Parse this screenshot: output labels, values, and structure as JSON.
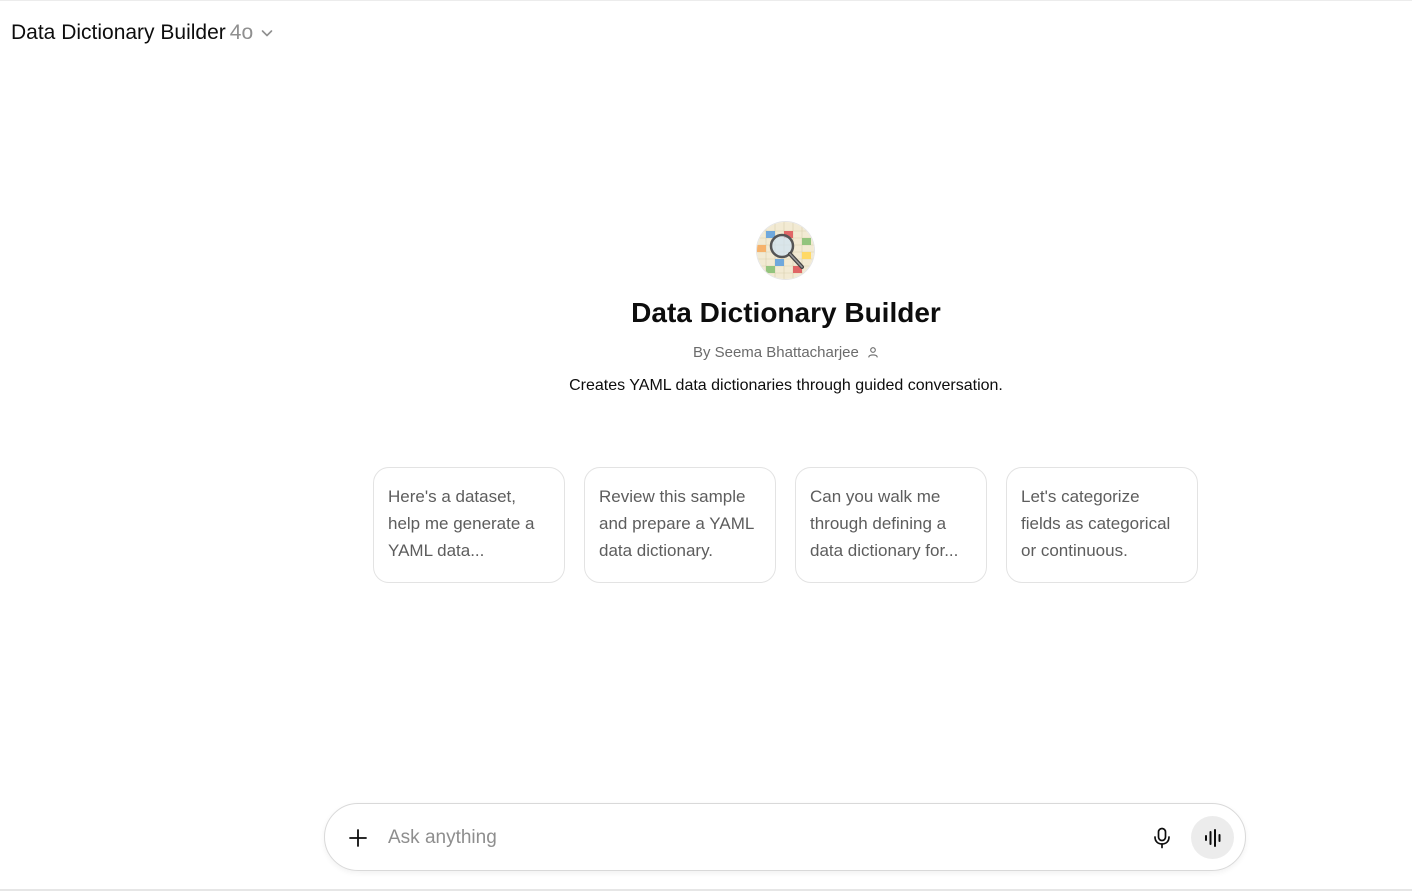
{
  "header": {
    "title": "Data Dictionary Builder",
    "model": "4o",
    "dropdown_icon": "chevron-down-icon"
  },
  "gpt": {
    "avatar_icon": "magnifier-over-spreadsheet-image",
    "name": "Data Dictionary Builder",
    "author": "By Seema Bhattacharjee",
    "author_icon": "person-icon",
    "description": "Creates YAML data dictionaries through guided conversation."
  },
  "starters": [
    {
      "text": "Here's a dataset, help me generate a YAML data..."
    },
    {
      "text": "Review this sample and prepare a YAML data dictionary."
    },
    {
      "text": "Can you walk me through defining a data dictionary for..."
    },
    {
      "text": "Let's categorize fields as categorical or continuous."
    }
  ],
  "composer": {
    "placeholder": "Ask anything",
    "value": "",
    "attach_icon": "plus-icon",
    "mic_icon": "microphone-icon",
    "voice_icon": "voice-mode-icon"
  },
  "colors": {
    "text": "#0d0d0d",
    "muted": "#8f8f8f",
    "card_text": "#5d5d5d",
    "border": "#e3e3e3",
    "voice_bg": "#ececec"
  }
}
